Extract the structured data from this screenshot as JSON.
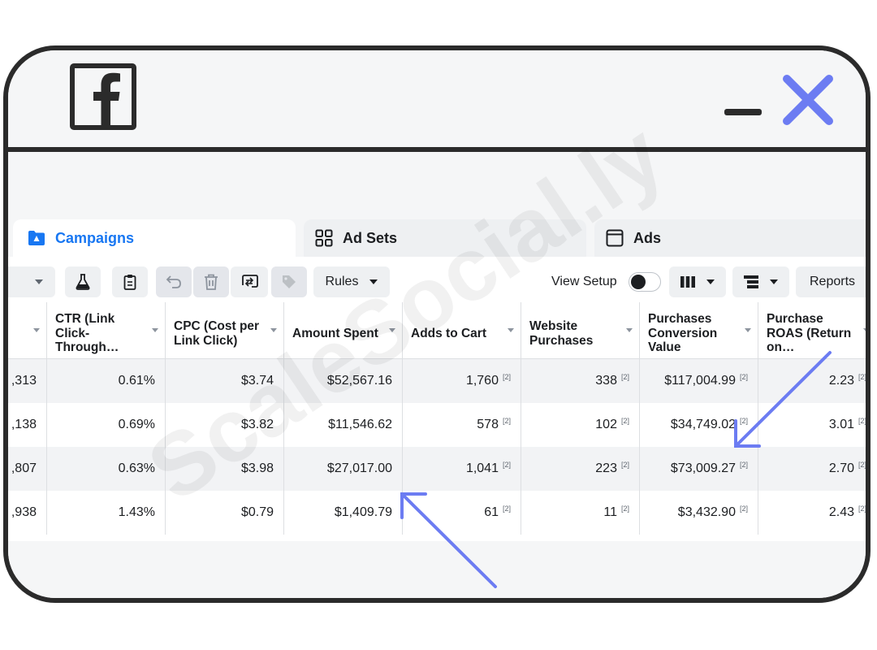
{
  "window": {
    "logo": "facebook-logo-icon",
    "minimize_icon": "minimize-icon",
    "close_icon": "close-icon",
    "accent": "#6c7cf2"
  },
  "tabs": [
    {
      "label": "Campaigns",
      "icon": "folder-icon",
      "active": true
    },
    {
      "label": "Ad Sets",
      "icon": "grid-icon",
      "active": false
    },
    {
      "label": "Ads",
      "icon": "ad-window-icon",
      "active": false
    }
  ],
  "toolbar": {
    "icons": [
      "dropdown-icon",
      "flask-icon",
      "clipboard-icon",
      "undo-icon",
      "trash-icon",
      "swap-icon",
      "tag-icon"
    ],
    "rules_label": "Rules",
    "view_setup_label": "View Setup",
    "view_setup_on": false,
    "reports_label": "Reports"
  },
  "table": {
    "columns": [
      "",
      "CTR (Link Click-Through…",
      "CPC (Cost per Link Click)",
      "Amount Spent",
      "Adds to Cart",
      "Website Purchases",
      "Purchases Conversion Value",
      "Purchase ROAS (Return on…"
    ],
    "rows": [
      [
        ",313",
        "0.61%",
        "$3.74",
        "$52,567.16",
        "1,760",
        "338",
        "$117,004.99",
        "2.23"
      ],
      [
        ",138",
        "0.69%",
        "$3.82",
        "$11,546.62",
        "578",
        "102",
        "$34,749.02",
        "3.01"
      ],
      [
        ",807",
        "0.63%",
        "$3.98",
        "$27,017.00",
        "1,041",
        "223",
        "$73,009.27",
        "2.70"
      ],
      [
        ",938",
        "1.43%",
        "$0.79",
        "$1,409.79",
        "61",
        "11",
        "$3,432.90",
        "2.43"
      ]
    ],
    "footnote_marker": "[2]"
  },
  "watermark": "ScaleSocial.ly"
}
